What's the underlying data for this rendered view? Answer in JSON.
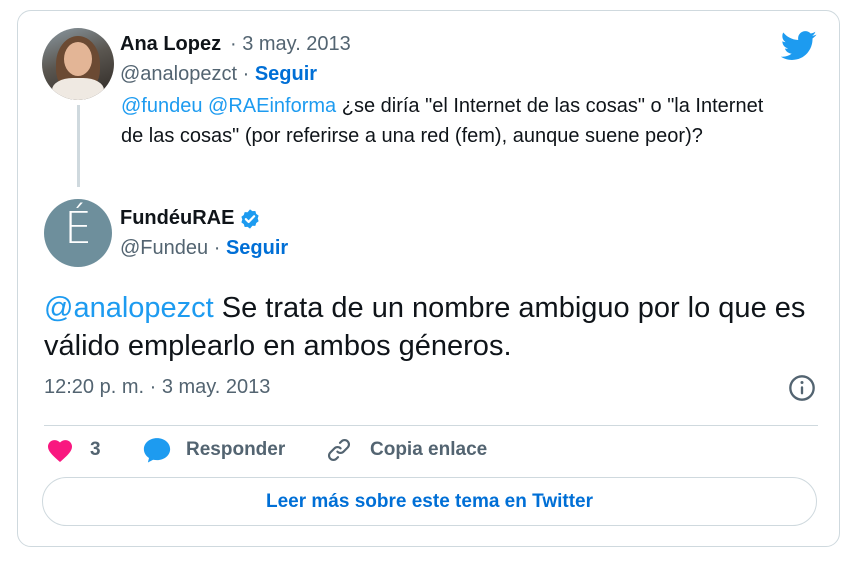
{
  "reply_tweet": {
    "author_name": "Ana Lopez",
    "date": "· 3 may. 2013",
    "handle": "@analopezct",
    "dot": "·",
    "follow_label": "Seguir",
    "mention_1": "@fundeu",
    "mention_2": "@RAEinforma",
    "text": "¿se diría \"el Internet de las cosas\" o \"la Internet de las cosas\" (por referirse a una red (fem), aunque suene peor)?"
  },
  "main_tweet": {
    "author_name": "FundéuRAE",
    "verified": true,
    "avatar_letter": "É",
    "handle": "@Fundeu",
    "dot": "·",
    "follow_label": "Seguir",
    "mention": "@analopezct",
    "text": "Se trata de un nombre ambiguo por lo que es válido emplearlo en ambos géneros.",
    "timestamp": "12:20 p. m. · 3 may. 2013"
  },
  "actions": {
    "like_count": "3",
    "reply_label": "Responder",
    "copy_link_label": "Copia enlace"
  },
  "read_more_label": "Leer más sobre este tema en Twitter",
  "colors": {
    "accent": "#1d9bf0",
    "link": "#006fd6",
    "like": "#f91880",
    "muted": "#536471",
    "border": "#cfd9de"
  },
  "icons": [
    "twitter-bird-icon",
    "verified-badge-icon",
    "info-icon",
    "heart-icon",
    "reply-bubble-icon",
    "link-icon"
  ]
}
